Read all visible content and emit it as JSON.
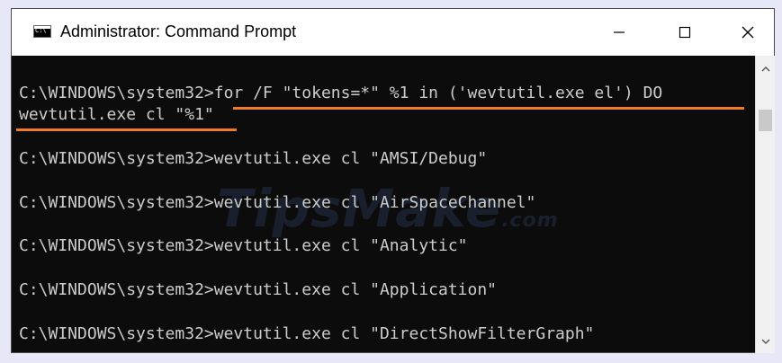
{
  "window": {
    "title": "Administrator: Command Prompt",
    "icon": "cmd-icon",
    "icon_text": "C:\\",
    "controls": [
      "minimize-icon",
      "maximize-icon",
      "close-icon"
    ]
  },
  "console": {
    "lines": [
      "C:\\WINDOWS\\system32>for /F \"tokens=*\" %1 in ('wevtutil.exe el') DO",
      "wevtutil.exe cl \"%1\"",
      "",
      "C:\\WINDOWS\\system32>wevtutil.exe cl \"AMSI/Debug\"",
      "",
      "C:\\WINDOWS\\system32>wevtutil.exe cl \"AirSpaceChannel\"",
      "",
      "C:\\WINDOWS\\system32>wevtutil.exe cl \"Analytic\"",
      "",
      "C:\\WINDOWS\\system32>wevtutil.exe cl \"Application\"",
      "",
      "C:\\WINDOWS\\system32>wevtutil.exe cl \"DirectShowFilterGraph\""
    ],
    "highlight_color": "#f27c22"
  },
  "watermark": {
    "text": "TipsMake",
    "suffix": ".com"
  },
  "colors": {
    "console_bg": "#0c0c0c",
    "console_text": "#cccccc",
    "titlebar_bg": "#ffffff"
  }
}
